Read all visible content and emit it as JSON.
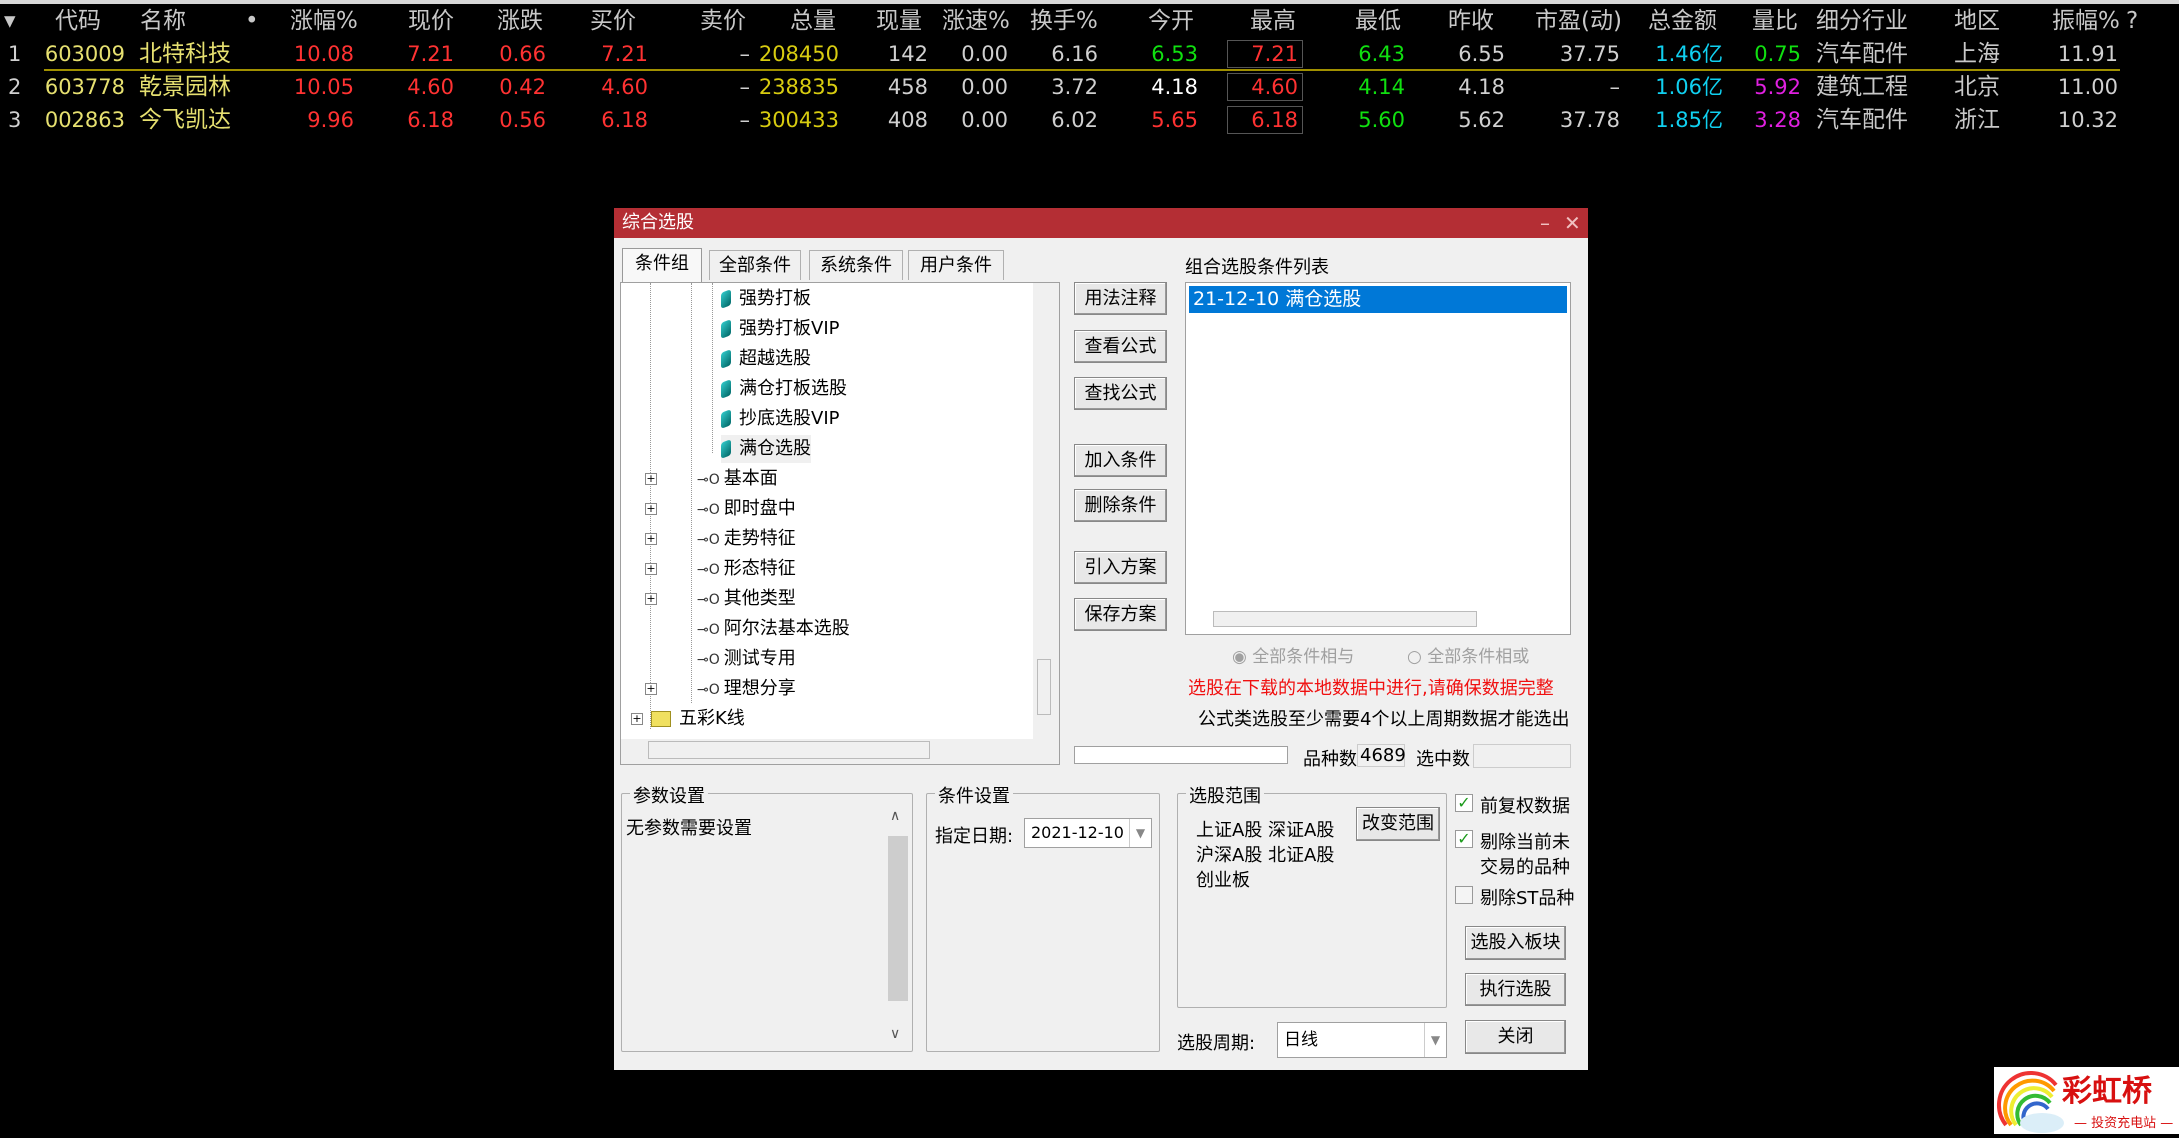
{
  "colors": {
    "red": "#ff3232",
    "yellow": "#e6e070",
    "gold": "#d8cc10",
    "white": "#d0d0d0",
    "bright": "#ffffff",
    "green": "#10e010",
    "cyan": "#10d0f0",
    "magenta": "#e020e0",
    "gray": "#c8c8c8",
    "title_bar": "#b42e34",
    "selection": "#0078d7"
  },
  "table": {
    "headers": [
      "▾",
      "代码",
      "名称",
      "•",
      "涨幅%",
      "现价",
      "涨跌",
      "买价",
      "卖价",
      "总量",
      "现量",
      "涨速%",
      "换手%",
      "今开",
      "最高",
      "最低",
      "昨收",
      "市盈(动)",
      "总金额",
      "量比",
      "细分行业",
      "地区",
      "振幅%",
      "?"
    ],
    "rows": [
      [
        {
          "v": "1",
          "c": "white"
        },
        {
          "v": "603009",
          "c": "yellow"
        },
        {
          "v": "北特科技",
          "c": "yellow"
        },
        {
          "v": "10.08",
          "c": "red"
        },
        {
          "v": "7.21",
          "c": "red"
        },
        {
          "v": "0.66",
          "c": "red"
        },
        {
          "v": "7.21",
          "c": "red"
        },
        {
          "v": "–",
          "c": "white"
        },
        {
          "v": "208450",
          "c": "gold"
        },
        {
          "v": "142",
          "c": "white"
        },
        {
          "v": "0.00",
          "c": "white"
        },
        {
          "v": "6.16",
          "c": "white"
        },
        {
          "v": "6.53",
          "c": "green"
        },
        {
          "v": "7.21",
          "c": "red"
        },
        {
          "v": "6.43",
          "c": "green"
        },
        {
          "v": "6.55",
          "c": "white"
        },
        {
          "v": "37.75",
          "c": "white"
        },
        {
          "v": "1.46亿",
          "c": "cyan"
        },
        {
          "v": "0.75",
          "c": "green"
        },
        {
          "v": "汽车配件",
          "c": "gray"
        },
        {
          "v": "上海",
          "c": "gray"
        },
        {
          "v": "11.91",
          "c": "white"
        }
      ],
      [
        {
          "v": "2",
          "c": "white"
        },
        {
          "v": "603778",
          "c": "yellow"
        },
        {
          "v": "乾景园林",
          "c": "yellow"
        },
        {
          "v": "10.05",
          "c": "red"
        },
        {
          "v": "4.60",
          "c": "red"
        },
        {
          "v": "0.42",
          "c": "red"
        },
        {
          "v": "4.60",
          "c": "red"
        },
        {
          "v": "–",
          "c": "white"
        },
        {
          "v": "238835",
          "c": "gold"
        },
        {
          "v": "458",
          "c": "white"
        },
        {
          "v": "0.00",
          "c": "white"
        },
        {
          "v": "3.72",
          "c": "white"
        },
        {
          "v": "4.18",
          "c": "bright"
        },
        {
          "v": "4.60",
          "c": "red"
        },
        {
          "v": "4.14",
          "c": "green"
        },
        {
          "v": "4.18",
          "c": "white"
        },
        {
          "v": "–",
          "c": "white"
        },
        {
          "v": "1.06亿",
          "c": "cyan"
        },
        {
          "v": "5.92",
          "c": "magenta"
        },
        {
          "v": "建筑工程",
          "c": "gray"
        },
        {
          "v": "北京",
          "c": "gray"
        },
        {
          "v": "11.00",
          "c": "white"
        }
      ],
      [
        {
          "v": "3",
          "c": "white"
        },
        {
          "v": "002863",
          "c": "yellow"
        },
        {
          "v": "今飞凯达",
          "c": "yellow"
        },
        {
          "v": "9.96",
          "c": "red"
        },
        {
          "v": "6.18",
          "c": "red"
        },
        {
          "v": "0.56",
          "c": "red"
        },
        {
          "v": "6.18",
          "c": "red"
        },
        {
          "v": "–",
          "c": "white"
        },
        {
          "v": "300433",
          "c": "gold"
        },
        {
          "v": "408",
          "c": "white"
        },
        {
          "v": "0.00",
          "c": "white"
        },
        {
          "v": "6.02",
          "c": "white"
        },
        {
          "v": "5.65",
          "c": "red"
        },
        {
          "v": "6.18",
          "c": "red"
        },
        {
          "v": "5.60",
          "c": "green"
        },
        {
          "v": "5.62",
          "c": "white"
        },
        {
          "v": "37.78",
          "c": "white"
        },
        {
          "v": "1.85亿",
          "c": "cyan"
        },
        {
          "v": "3.28",
          "c": "magenta"
        },
        {
          "v": "汽车配件",
          "c": "gray"
        },
        {
          "v": "浙江",
          "c": "gray"
        },
        {
          "v": "10.32",
          "c": "white"
        }
      ]
    ]
  },
  "dialog": {
    "title": "综合选股",
    "minimize": "–",
    "close": "✕",
    "tabs": [
      "条件组",
      "全部条件",
      "系统条件",
      "用户条件"
    ],
    "tree": [
      {
        "label": "强势打板",
        "type": "leaf"
      },
      {
        "label": "强势打板VIP",
        "type": "leaf"
      },
      {
        "label": "超越选股",
        "type": "leaf"
      },
      {
        "label": "满仓打板选股",
        "type": "leaf"
      },
      {
        "label": "抄底选股VIP",
        "type": "leaf"
      },
      {
        "label": "满仓选股",
        "type": "leaf",
        "selected": true
      },
      {
        "label": "基本面",
        "type": "group",
        "expandable": true
      },
      {
        "label": "即时盘中",
        "type": "group",
        "expandable": true
      },
      {
        "label": "走势特征",
        "type": "group",
        "expandable": true
      },
      {
        "label": "形态特征",
        "type": "group",
        "expandable": true
      },
      {
        "label": "其他类型",
        "type": "group",
        "expandable": true
      },
      {
        "label": "阿尔法基本选股",
        "type": "group",
        "expandable": false
      },
      {
        "label": "测试专用",
        "type": "group",
        "expandable": false
      },
      {
        "label": "理想分享",
        "type": "group",
        "expandable": true
      },
      {
        "label": "五彩K线",
        "type": "folder",
        "expandable": true
      }
    ],
    "buttons": [
      "用法注释",
      "查看公式",
      "查找公式",
      "加入条件",
      "删除条件",
      "引入方案",
      "保存方案"
    ],
    "condition_list_label": "组合选股条件列表",
    "condition_list": [
      "21-12-10 满仓选股"
    ],
    "radio_and": "全部条件相与",
    "radio_or": "全部条件相或",
    "warning": "选股在下载的本地数据中进行,请确保数据完整",
    "note": "公式类选股至少需要4个以上周期数据才能选出",
    "count_label": "品种数",
    "count_value": "4689",
    "selected_label": "选中数",
    "selected_value": "",
    "params": {
      "title": "参数设置",
      "text": "无参数需要设置"
    },
    "cond": {
      "title": "条件设置",
      "date_label": "指定日期:",
      "date_value": "2021-12-10"
    },
    "range": {
      "title": "选股范围",
      "lines": [
        "上证A股 深证A股",
        "沪深A股 北证A股",
        "创业板"
      ],
      "change_button": "改变范围"
    },
    "checks": [
      {
        "label": "前复权数据",
        "checked": true
      },
      {
        "label": "剔除当前未",
        "label2": "交易的品种",
        "checked": true
      },
      {
        "label": "剔除ST品种",
        "checked": false
      }
    ],
    "to_block": "选股入板块",
    "execute": "执行选股",
    "close_button": "关闭",
    "period_label": "选股周期:",
    "period_value": "日线"
  },
  "logo": {
    "text": "彩虹桥",
    "sub": "投资充电站"
  }
}
